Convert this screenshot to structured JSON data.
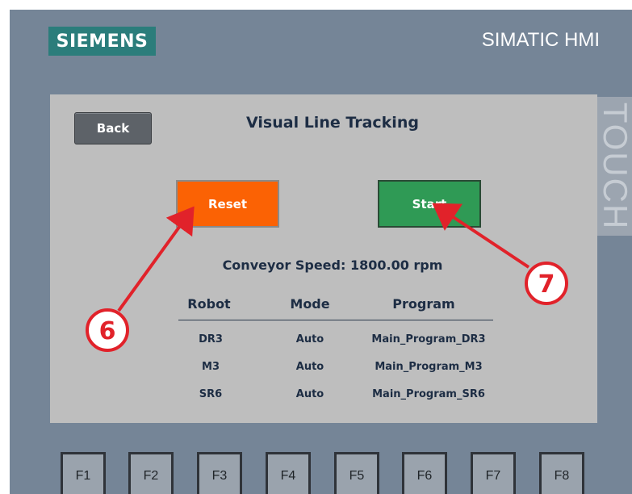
{
  "device": {
    "brand": "SIEMENS",
    "product": "SIMATIC HMI",
    "side_label": "TOUCH"
  },
  "screen": {
    "back_label": "Back",
    "title": "Visual Line Tracking",
    "reset_label": "Reset",
    "start_label": "Start",
    "conveyor_speed": "Conveyor Speed: 1800.00 rpm",
    "table": {
      "headers": [
        "Robot",
        "Mode",
        "Program"
      ],
      "rows": [
        [
          "DR3",
          "Auto",
          "Main_Program_DR3"
        ],
        [
          "M3",
          "Auto",
          "Main_Program_M3"
        ],
        [
          "SR6",
          "Auto",
          "Main_Program_SR6"
        ]
      ]
    }
  },
  "function_keys": [
    "F1",
    "F2",
    "F3",
    "F4",
    "F5",
    "F6",
    "F7",
    "F8"
  ],
  "annotations": {
    "callouts": [
      "6",
      "7"
    ],
    "color": "#e1222a"
  },
  "colors": {
    "reset": "#fb6204",
    "start": "#2f9a55",
    "brand_badge": "#2b7d7b",
    "bezel": "#758597"
  }
}
